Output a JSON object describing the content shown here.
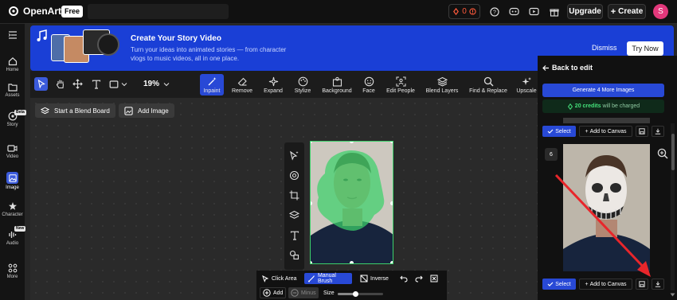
{
  "app": {
    "name": "OpenArt",
    "plan_badge": "Free"
  },
  "topbar": {
    "credits": "0",
    "upgrade": "Upgrade",
    "create": "Create",
    "avatar_initial": "S"
  },
  "sidebar": {
    "items": [
      {
        "label": "Home",
        "icon": "home-icon"
      },
      {
        "label": "Assets",
        "icon": "folder-icon"
      },
      {
        "label": "Story",
        "icon": "story-icon",
        "badge": "Beta"
      },
      {
        "label": "Video",
        "icon": "video-icon"
      },
      {
        "label": "Image",
        "icon": "image-icon"
      },
      {
        "label": "Character",
        "icon": "character-icon"
      },
      {
        "label": "Audio",
        "icon": "audio-icon",
        "badge": "New"
      },
      {
        "label": "More",
        "icon": "more-icon"
      }
    ]
  },
  "banner": {
    "title": "Create Your Story Video",
    "desc_line1": "Turn your ideas into animated stories — from character",
    "desc_line2": "vlogs to music videos, all in one place.",
    "dismiss": "Dismiss",
    "try_now": "Try Now"
  },
  "toolbar": {
    "zoom": "19%",
    "actions": [
      "Inpaint",
      "Remove",
      "Expand",
      "Stylize",
      "Background",
      "Face",
      "Edit People",
      "Blend Layers",
      "Find & Replace",
      "Upscale"
    ]
  },
  "canvas": {
    "blend_board": "Start a Blend Board",
    "add_image": "Add Image"
  },
  "brush_bar": {
    "click_area": "Click Area",
    "manual_brush": "Manual Brush",
    "inverse": "Inverse",
    "add": "Add",
    "minus": "Minus",
    "size": "Size",
    "size_value": 0.4
  },
  "right_panel": {
    "back": "Back to edit",
    "generate": "Generate 4 More Images",
    "credits_amount": "20 credits",
    "credits_suffix": "will be charged",
    "select": "Select",
    "add_to_canvas": "Add to Canvas",
    "result_number": "6"
  },
  "colors": {
    "accent": "#2849d6",
    "mask": "#3bd16b",
    "credits_red": "#ff5a3c"
  }
}
